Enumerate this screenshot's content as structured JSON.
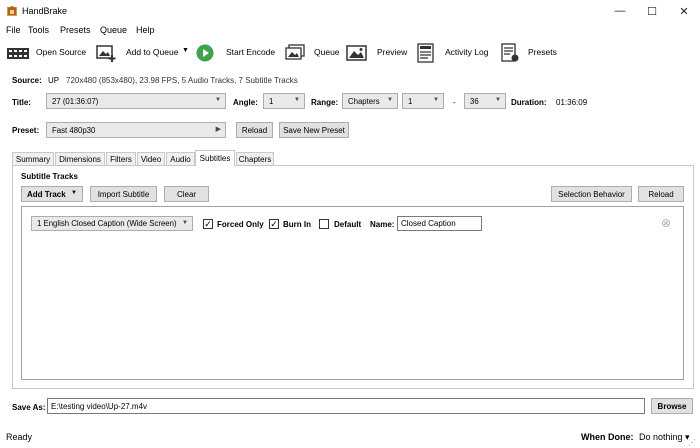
{
  "window": {
    "title": "HandBrake",
    "minimize": "—",
    "maximize": "☐",
    "close": "✕"
  },
  "menu": [
    "File",
    "Tools",
    "Presets",
    "Queue",
    "Help"
  ],
  "toolbar": {
    "open_source": "Open Source",
    "add_to_queue": "Add to Queue",
    "start_encode": "Start Encode",
    "queue": "Queue",
    "preview": "Preview",
    "activity_log": "Activity Log",
    "presets": "Presets"
  },
  "source": {
    "label": "Source:",
    "name": "UP",
    "info": "720x480 (853x480), 23.98 FPS, 5 Audio Tracks, 7 Subtitle Tracks"
  },
  "title_row": {
    "title_label": "Title:",
    "title_value": "27  (01:36:07)",
    "angle_label": "Angle:",
    "angle_value": "1",
    "range_label": "Range:",
    "range_value": "Chapters",
    "start": "1",
    "dash": "-",
    "end": "36",
    "duration_label": "Duration:",
    "duration_value": "01:36:09"
  },
  "preset_row": {
    "label": "Preset:",
    "value": "Fast 480p30",
    "reload": "Reload",
    "save_new": "Save New Preset"
  },
  "tabs": [
    "Summary",
    "Dimensions",
    "Filters",
    "Video",
    "Audio",
    "Subtitles",
    "Chapters"
  ],
  "active_tab": "Subtitles",
  "subtitles": {
    "heading": "Subtitle Tracks",
    "add_track": "Add Track",
    "import": "Import Subtitle",
    "clear": "Clear",
    "selection_behavior": "Selection Behavior",
    "reload": "Reload",
    "track": {
      "value": "1 English Closed Caption (Wide Screen)",
      "forced_only": "Forced Only",
      "forced_checked": true,
      "burn_in": "Burn In",
      "burn_checked": true,
      "default": "Default",
      "default_checked": false,
      "name_label": "Name:",
      "name_value": "Closed Caption",
      "remove": "⊗"
    }
  },
  "save_as": {
    "label": "Save As:",
    "value": "E:\\testing video\\Up-27.m4v",
    "browse": "Browse"
  },
  "status": {
    "text": "Ready",
    "when_done_label": "When Done:",
    "when_done_value": "Do nothing ▾"
  }
}
